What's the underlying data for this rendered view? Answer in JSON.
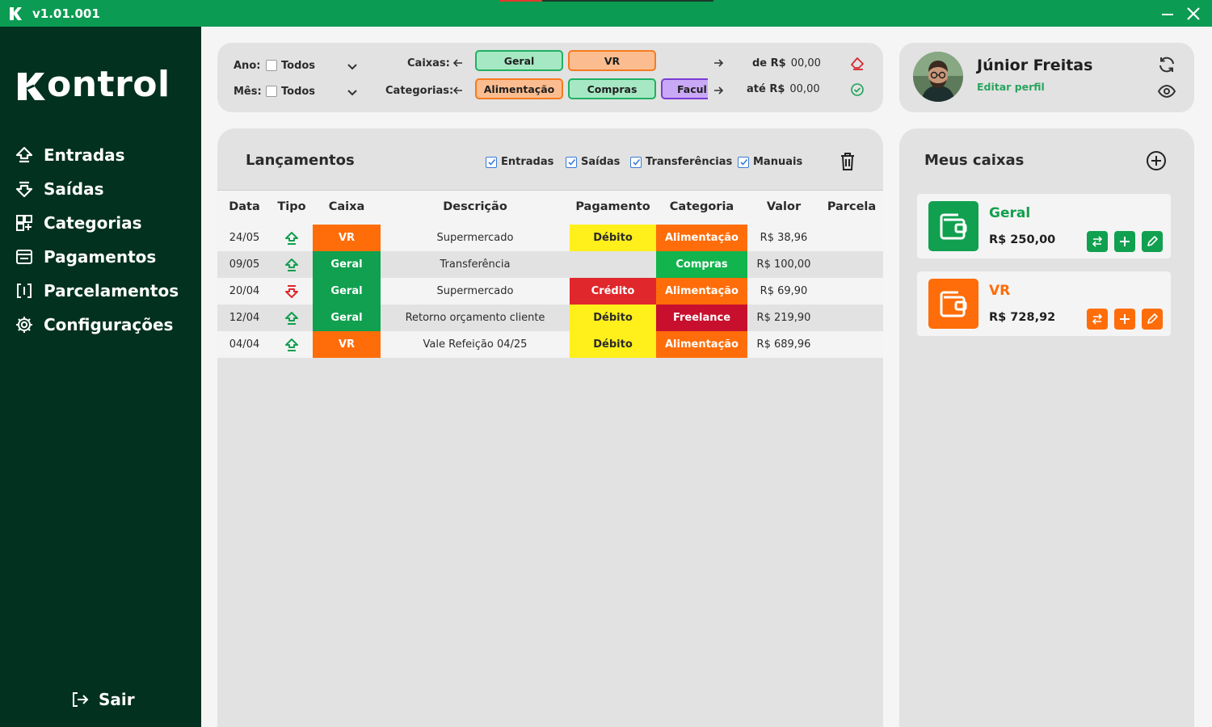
{
  "app": {
    "version": "v1.01.001",
    "brand": "Kontrol",
    "progress_fraction": 0.2
  },
  "colors": {
    "titlebar": "#0c9b53",
    "sidebar": "#03311f",
    "green": "#11a04f",
    "orange": "#fe6d09",
    "red": "#e0272c",
    "yellow": "#ffef1a",
    "freelance": "#c8102e",
    "compras": "#12b44d"
  },
  "sidebar": {
    "items": [
      {
        "label": "Entradas",
        "icon": "arrow-up-outline-icon"
      },
      {
        "label": "Saídas",
        "icon": "arrow-down-outline-icon"
      },
      {
        "label": "Categorias",
        "icon": "grid-plus-icon"
      },
      {
        "label": "Pagamentos",
        "icon": "receipt-icon"
      },
      {
        "label": "Parcelamentos",
        "icon": "brackets-icon"
      },
      {
        "label": "Configurações",
        "icon": "gear-icon"
      }
    ],
    "logout": "Sair"
  },
  "filters": {
    "ano_label": "Ano:",
    "ano_value": "Todos",
    "mes_label": "Mês:",
    "mes_value": "Todos",
    "caixas_label": "Caixas:",
    "categorias_label": "Categorias:",
    "caixas_chips": [
      "Geral",
      "VR"
    ],
    "categorias_chips": [
      "Alimentação",
      "Compras",
      "Facul"
    ],
    "de_label": "de R$",
    "de_value": "00,00",
    "ate_label": "até R$",
    "ate_value": "00,00"
  },
  "profile": {
    "name": "Júnior Freitas",
    "edit": "Editar perfil"
  },
  "lancamentos": {
    "title": "Lançamentos",
    "toggles": [
      "Entradas",
      "Saídas",
      "Transferências",
      "Manuais"
    ],
    "headers": [
      "Data",
      "Tipo",
      "Caixa",
      "Descrição",
      "Pagamento",
      "Categoria",
      "Valor",
      "Parcela"
    ],
    "rows": [
      {
        "data": "24/05",
        "tipo": "entrada",
        "caixa": "VR",
        "caixa_color": "#fe6d09",
        "descricao": "Supermercado",
        "pagamento": "Débito",
        "pag_color": "#ffef1a",
        "categoria": "Alimentação",
        "cat_color": "#fe6d09",
        "valor": "R$ 38,96",
        "parcela": ""
      },
      {
        "data": "09/05",
        "tipo": "entrada",
        "caixa": "Geral",
        "caixa_color": "#11a04f",
        "descricao": "Transferência",
        "pagamento": "",
        "pag_color": "",
        "categoria": "Compras",
        "cat_color": "#12b44d",
        "valor": "R$ 100,00",
        "parcela": ""
      },
      {
        "data": "20/04",
        "tipo": "saida",
        "caixa": "Geral",
        "caixa_color": "#11a04f",
        "descricao": "Supermercado",
        "pagamento": "Crédito",
        "pag_color": "#e0272c",
        "categoria": "Alimentação",
        "cat_color": "#fe6d09",
        "valor": "R$ 69,90",
        "parcela": ""
      },
      {
        "data": "12/04",
        "tipo": "entrada",
        "caixa": "Geral",
        "caixa_color": "#11a04f",
        "descricao": "Retorno orçamento cliente",
        "pagamento": "Débito",
        "pag_color": "#ffef1a",
        "categoria": "Freelance",
        "cat_color": "#c8102e",
        "valor": "R$ 219,90",
        "parcela": ""
      },
      {
        "data": "04/04",
        "tipo": "entrada",
        "caixa": "VR",
        "caixa_color": "#fe6d09",
        "descricao": "Vale Refeição 04/25",
        "pagamento": "Débito",
        "pag_color": "#ffef1a",
        "categoria": "Alimentação",
        "cat_color": "#fe6d09",
        "valor": "R$ 689,96",
        "parcela": ""
      }
    ]
  },
  "caixas": {
    "title": "Meus caixas",
    "cards": [
      {
        "name": "Geral",
        "value": "R$ 250,00",
        "color": "#11a04f"
      },
      {
        "name": "VR",
        "value": "R$ 728,92",
        "color": "#fe6d09"
      }
    ]
  }
}
